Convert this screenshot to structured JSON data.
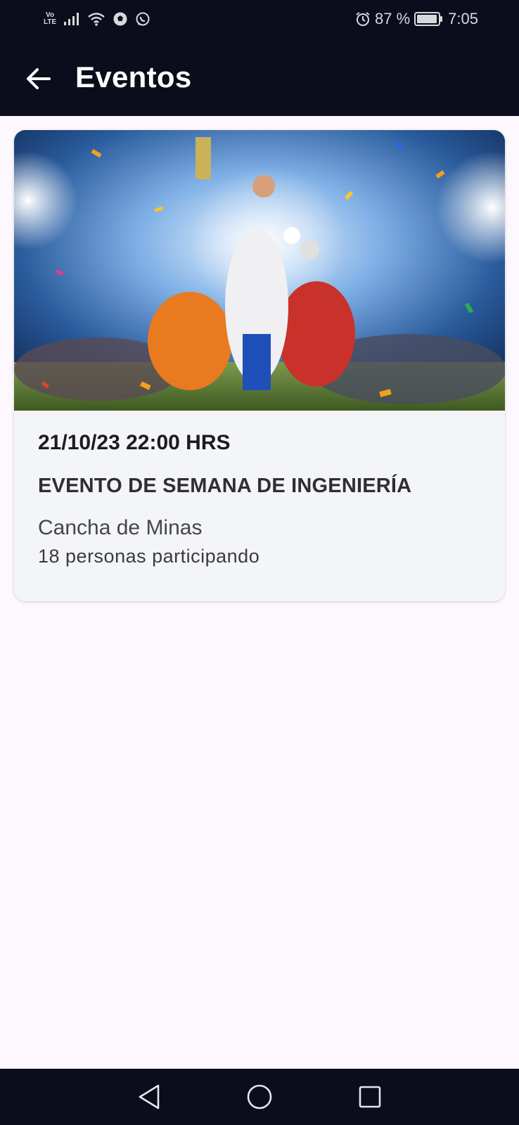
{
  "status_bar": {
    "volte_top": "Vo",
    "volte_bottom": "LTE",
    "battery": "87 %",
    "time": "7:05",
    "icons": [
      "signal-icon",
      "wifi-icon",
      "soccer-ball-icon",
      "whatsapp-icon",
      "alarm-icon",
      "battery-icon"
    ]
  },
  "app_bar": {
    "title": "Eventos",
    "back_icon": "arrow-left-icon"
  },
  "event": {
    "date": "21/10/23 22:00 HRS",
    "title": "EVENTO DE SEMANA DE INGENIERÍA",
    "place": "Cancha de Minas",
    "participants": "18 personas participando",
    "image": "sports-players-stadium-image"
  },
  "nav_bar": {
    "icons": [
      "back-triangle-icon",
      "home-circle-icon",
      "recents-square-icon"
    ]
  },
  "colors": {
    "bar_bg": "#0b0d1c",
    "page_bg": "#fdf8fd",
    "card_bg": "#f3f5f6"
  }
}
